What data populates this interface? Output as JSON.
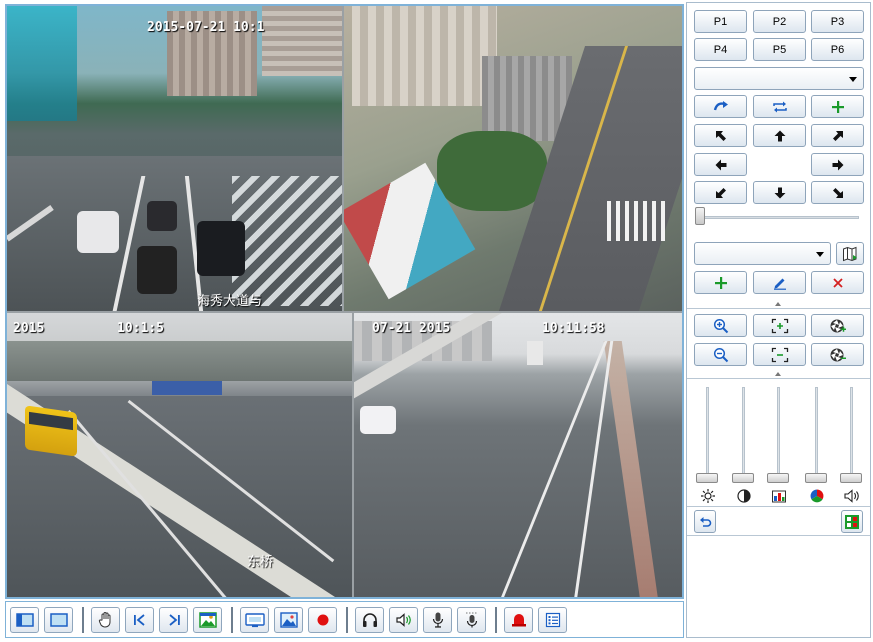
{
  "cameras": [
    {
      "id": "cam1",
      "timestamp": "2015-07-21 10:1",
      "caption": "海秀大道与"
    },
    {
      "id": "cam2",
      "timestamp": "",
      "caption": ""
    },
    {
      "id": "cam3",
      "timestamp": "2015",
      "timestamp2": "10:1:5",
      "caption": "东桥"
    },
    {
      "id": "cam4",
      "timestamp": "07-21 2015",
      "timestamp2": "10:11:58",
      "caption": ""
    }
  ],
  "toolbar": {
    "buttons": [
      {
        "name": "layout-single-button",
        "icon": "single-window-icon"
      },
      {
        "name": "layout-full-button",
        "icon": "full-window-icon"
      },
      {
        "name": "ptz-hand-button",
        "icon": "hand-icon"
      },
      {
        "name": "previous-button",
        "icon": "previous-icon"
      },
      {
        "name": "next-button",
        "icon": "next-icon"
      },
      {
        "name": "snapshot-button",
        "icon": "picture-icon"
      },
      {
        "name": "stream-button",
        "icon": "monitor-icon"
      },
      {
        "name": "capture-button",
        "icon": "image-icon"
      },
      {
        "name": "record-button",
        "icon": "record-icon"
      },
      {
        "name": "listen-button",
        "icon": "headphones-icon"
      },
      {
        "name": "speaker-button",
        "icon": "speaker-icon"
      },
      {
        "name": "talk-button",
        "icon": "microphone-icon"
      },
      {
        "name": "broadcast-button",
        "icon": "intercom-icon"
      },
      {
        "name": "alarm-button",
        "icon": "alarm-icon"
      },
      {
        "name": "list-button",
        "icon": "list-icon"
      }
    ]
  },
  "panel": {
    "presets": [
      "P1",
      "P2",
      "P3",
      "P4",
      "P5",
      "P6"
    ],
    "preset_select": "",
    "cruise_select": "",
    "colors": {
      "accent": "#1b5fc4",
      "add": "#1a9a2a",
      "delete": "#d42020",
      "record": "#e01010"
    }
  }
}
